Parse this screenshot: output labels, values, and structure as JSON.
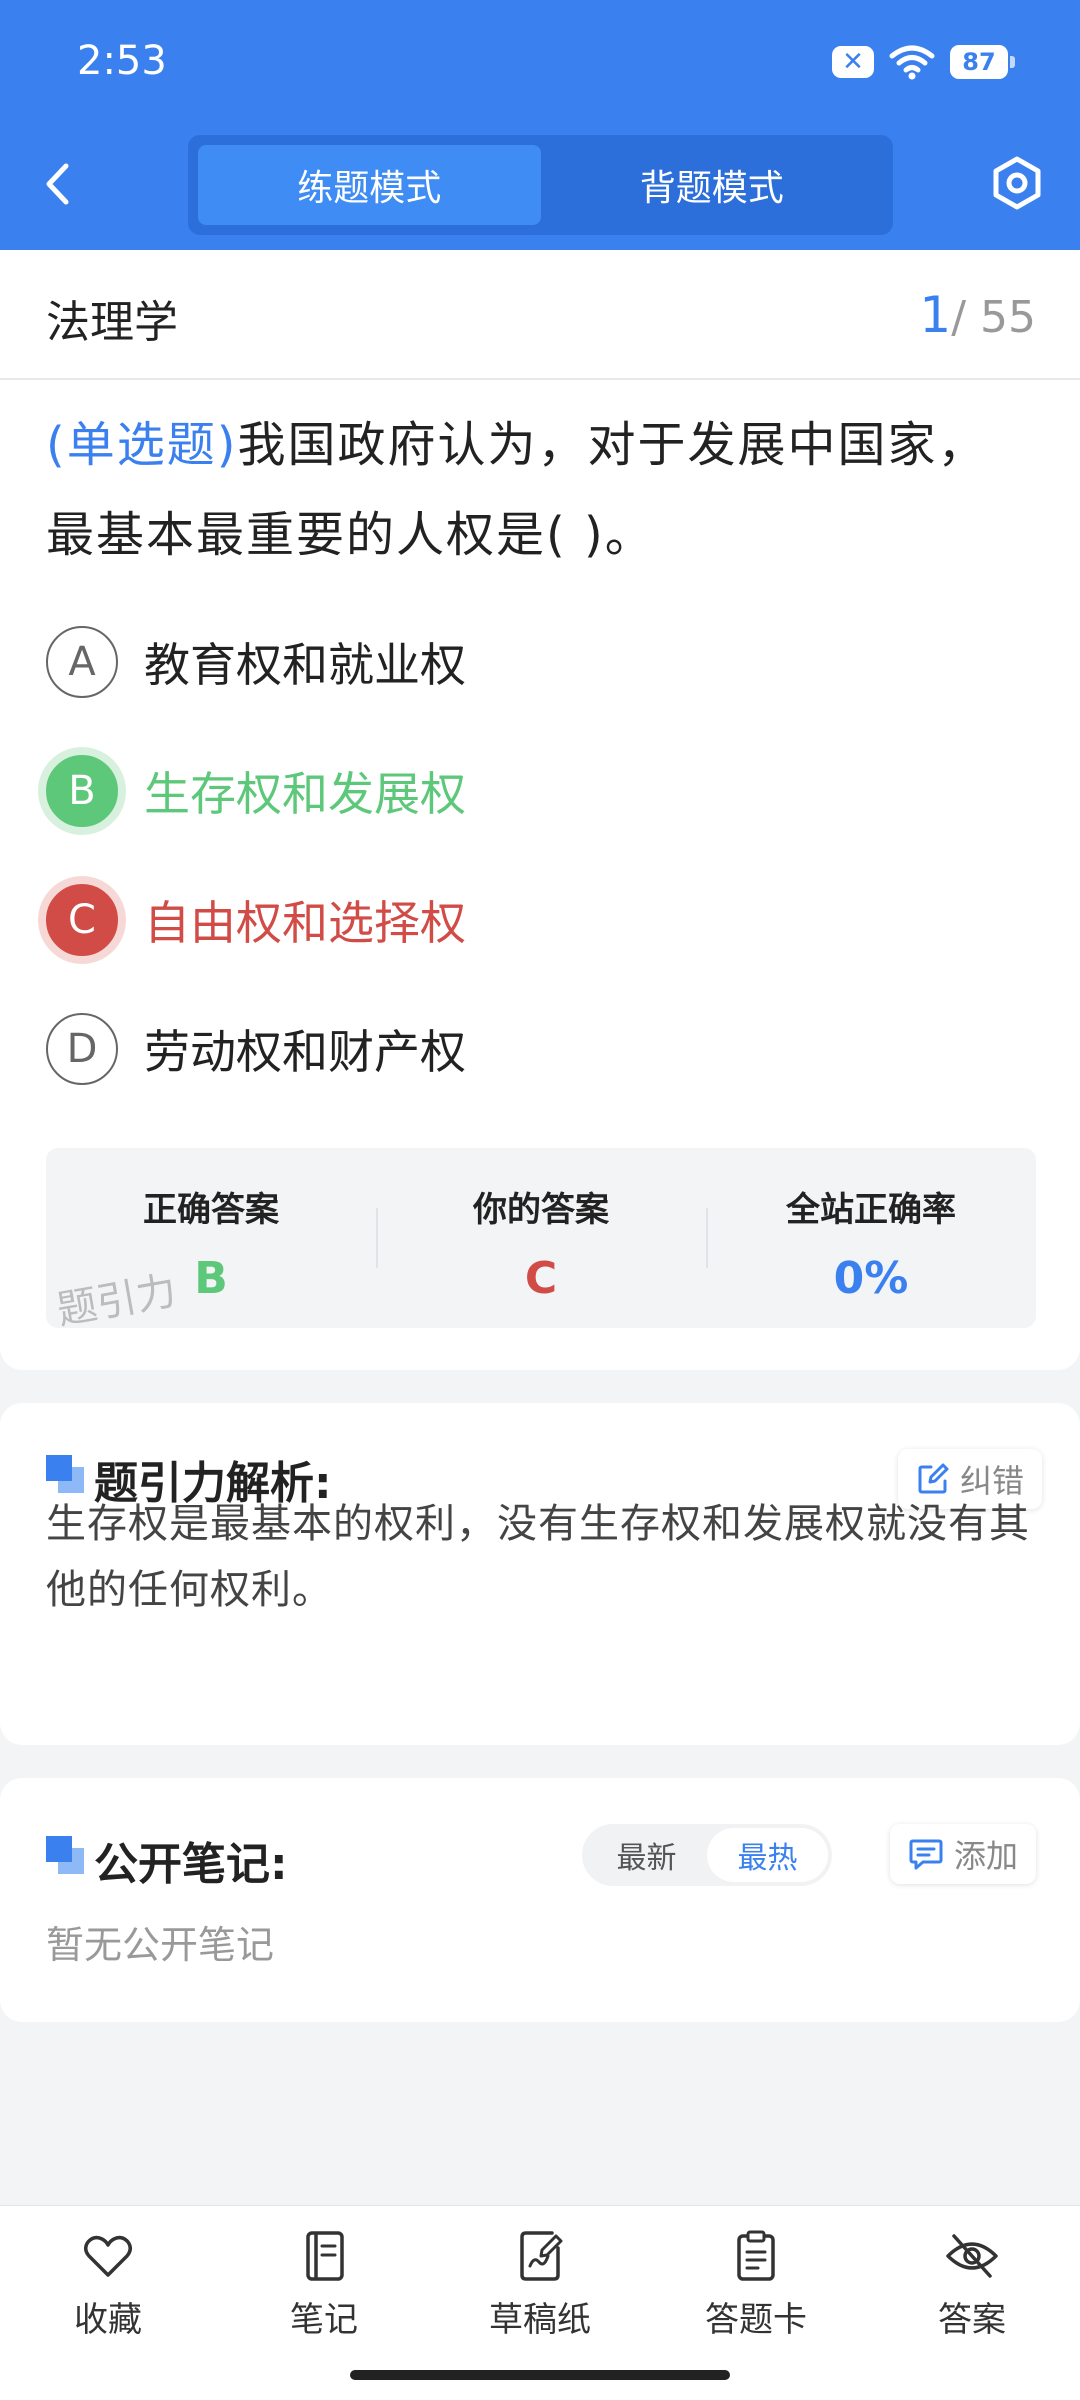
{
  "status_bar": {
    "time": "2:53",
    "battery": "87"
  },
  "header": {
    "modes": [
      "练题模式",
      "背题模式"
    ],
    "active_mode": "练题模式"
  },
  "question_card": {
    "subject": "法理学",
    "current": "1",
    "total": "/ 55",
    "type": "(单选题)",
    "text": "我国政府认为，对于发展中国家，最基本最重要的人权是(        )。",
    "options": [
      {
        "letter": "A",
        "text": "教育权和就业权",
        "state": "normal"
      },
      {
        "letter": "B",
        "text": "生存权和发展权",
        "state": "correct"
      },
      {
        "letter": "C",
        "text": "自由权和选择权",
        "state": "wrong"
      },
      {
        "letter": "D",
        "text": "劳动权和财产权",
        "state": "normal"
      }
    ],
    "answer": {
      "correct_label": "正确答案",
      "correct_value": "B",
      "yours_label": "你的答案",
      "yours_value": "C",
      "rate_label": "全站正确率",
      "rate_value": "0%"
    },
    "watermark": "题引力"
  },
  "analysis": {
    "title": "题引力解析:",
    "report_label": "纠错",
    "text": "生存权是最基本的权利，没有生存权和发展权就没有其他的任何权利。"
  },
  "notes": {
    "title": "公开笔记:",
    "sort_options": [
      "最新",
      "最热"
    ],
    "active_sort": "最热",
    "add_label": "添加",
    "empty_text": "暂无公开笔记"
  },
  "bottom_bar": {
    "tabs": [
      {
        "label": "收藏",
        "icon": "heart-icon"
      },
      {
        "label": "笔记",
        "icon": "notebook-icon"
      },
      {
        "label": "草稿纸",
        "icon": "draft-paper-icon"
      },
      {
        "label": "答题卡",
        "icon": "answer-sheet-icon"
      },
      {
        "label": "答案",
        "icon": "eye-off-icon"
      }
    ]
  },
  "colors": {
    "primary": "#3b80ef",
    "correct": "#5dc77a",
    "wrong": "#d14c46"
  }
}
